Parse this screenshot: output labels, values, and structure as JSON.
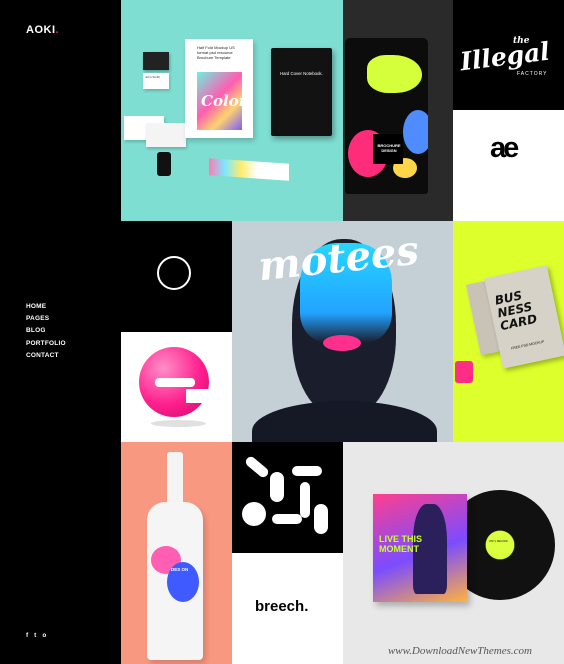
{
  "brand": {
    "name": "AOKI",
    "dot": ".",
    "accent": "#ff1f6b"
  },
  "nav": {
    "items": [
      "HOME",
      "PAGES",
      "BLOG",
      "PORTFOLIO",
      "CONTACT"
    ]
  },
  "social": {
    "icons": [
      "facebook-icon",
      "twitter-icon",
      "instagram-icon"
    ],
    "glyphs": [
      "f",
      "t",
      "o"
    ]
  },
  "gallery": {
    "brochure": {
      "card_name": "John Smith",
      "pamphlet_text": "Half Fold Mockup US format psd resource Brochure Template",
      "pamphlet_title": "Color",
      "notebook_text": "Hard Cover Notebook."
    },
    "pouch": {
      "label": "BROCHURE DESIGN"
    },
    "illegal": {
      "the": "the",
      "title": "Illegal",
      "subtitle": "FACTORY"
    },
    "ae": {
      "text": "ae"
    },
    "motees": {
      "title": "motees"
    },
    "business": {
      "title": "BUS NESS CARD",
      "sub": "FREE PSD MOCKUP"
    },
    "bottle": {
      "label": "DES ON"
    },
    "breech": {
      "text": "breech."
    },
    "vinyl": {
      "cover_text": "LIVE THIS MOMENT",
      "label": "VINYL RECORD"
    }
  },
  "watermark": "www.DownloadNewThemes.com",
  "colors": {
    "sidebar": "#000000",
    "mint": "#7fded2",
    "lime": "#ddff2b",
    "pink": "#ff2c7a",
    "salmon": "#f99880",
    "grey": "#e8e8e8"
  }
}
